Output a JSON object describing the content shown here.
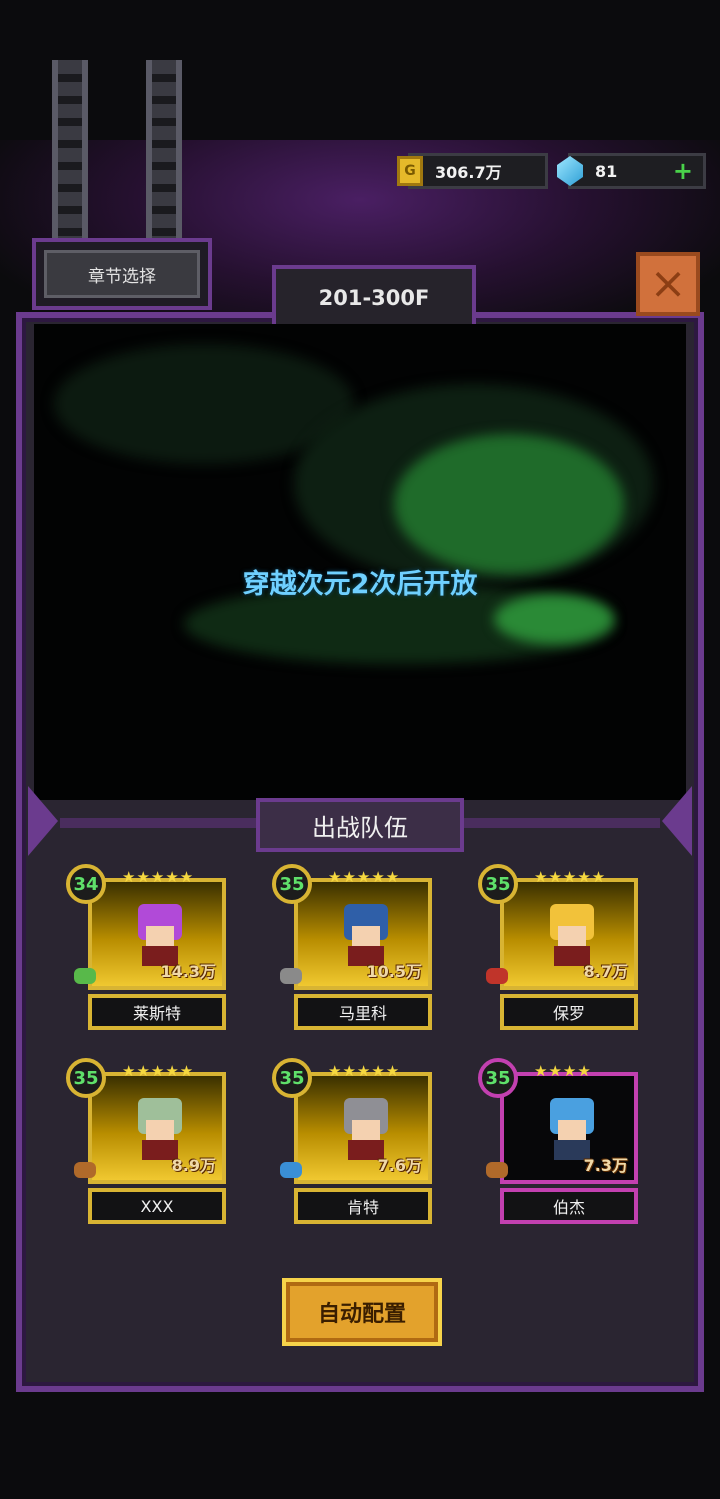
{
  "currency": {
    "gold": "306.7万",
    "gems": "81",
    "add_label": "+"
  },
  "chapter_select_label": "章节选择",
  "floor_range": "201-300F",
  "close_label": "×",
  "stage_lock_text": "穿越次元2次后开放",
  "team_title": "出战队伍",
  "heroes": [
    {
      "name": "莱斯特",
      "level": "34",
      "stars": "★★★★★",
      "power": "14.3万",
      "hair": "#b14ad8",
      "weapon": "#58b94a"
    },
    {
      "name": "马里科",
      "level": "35",
      "stars": "★★★★★",
      "power": "10.5万",
      "hair": "#2f5fa8",
      "weapon": "#8a8a8a"
    },
    {
      "name": "保罗",
      "level": "35",
      "stars": "★★★★★",
      "power": "8.7万",
      "hair": "#f2c23a",
      "weapon": "#c0342a"
    },
    {
      "name": "XXX",
      "level": "35",
      "stars": "★★★★★",
      "power": "8.9万",
      "hair": "#9fbf9a",
      "weapon": "#b06a2a"
    },
    {
      "name": "肯特",
      "level": "35",
      "stars": "★★★★★",
      "power": "7.6万",
      "hair": "#8f8f95",
      "weapon": "#3a8fd6"
    },
    {
      "name": "伯杰",
      "level": "35",
      "stars": "★★★★",
      "power": "7.3万",
      "hair": "#4aa0e0",
      "weapon": "#b06a2a"
    }
  ],
  "auto_config_label": "自动配置",
  "colors": {
    "frame": "#6b3b8e",
    "gold_border": "#d8b433",
    "epic_border": "#c240b0",
    "level_text": "#5fe06a",
    "lock_text": "#6fd0ff"
  }
}
